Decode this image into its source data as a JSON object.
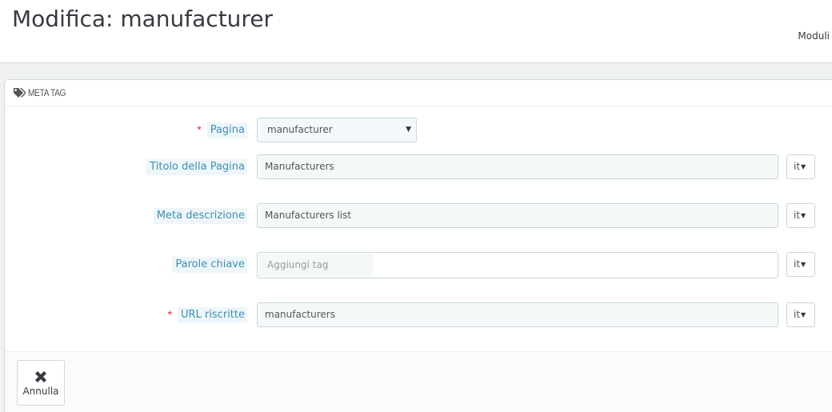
{
  "header": {
    "title": "Modifica: manufacturer",
    "toolbar_link": "Moduli"
  },
  "panel": {
    "heading": "META TAG",
    "heading_icon": "tags-icon"
  },
  "form": {
    "page": {
      "label": "Pagina",
      "required": true,
      "value": "manufacturer"
    },
    "title": {
      "label": "Titolo della Pagina",
      "value": "Manufacturers",
      "lang": "it"
    },
    "description": {
      "label": "Meta descrizione",
      "value": "Manufacturers list",
      "lang": "it"
    },
    "keywords": {
      "label": "Parole chiave",
      "placeholder": "Aggiungi tag",
      "lang": "it"
    },
    "url": {
      "label": "URL riscritte",
      "required": true,
      "value": "manufacturers",
      "lang": "it"
    }
  },
  "footer": {
    "cancel_label": "Annulla"
  },
  "colors": {
    "label_text": "#3f8fb1",
    "label_bg": "#eef6fa",
    "required": "#e32a2a",
    "border": "#c7d6db"
  }
}
